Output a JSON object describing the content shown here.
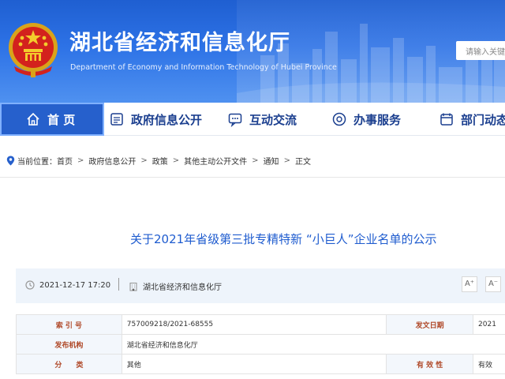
{
  "header": {
    "title": "湖北省经济和信息化厅",
    "subtitle": "Department of Economy and Information Technology of Hubei Province",
    "search_placeholder": "请输入关键",
    "brand_color": "#2d72e6"
  },
  "nav": {
    "items": [
      {
        "label": "首 页",
        "icon": "home-icon",
        "active": true
      },
      {
        "label": "政府信息公开",
        "icon": "document-icon",
        "active": false
      },
      {
        "label": "互动交流",
        "icon": "chat-icon",
        "active": false
      },
      {
        "label": "办事服务",
        "icon": "service-icon",
        "active": false
      },
      {
        "label": "部门动态",
        "icon": "news-icon",
        "active": false
      }
    ]
  },
  "breadcrumb": {
    "prefix": "当前位置：",
    "items": [
      "首页",
      "政府信息公开",
      "政策",
      "其他主动公开文件",
      "通知",
      "正文"
    ]
  },
  "article": {
    "title": "关于2021年省级第三批专精特新 “小巨人”企业名单的公示",
    "date": "2021-12-17 17:20",
    "source": "湖北省经济和信息化厅",
    "font_larger": "A⁺",
    "font_smaller": "A⁻"
  },
  "info_table": {
    "rows": [
      {
        "label1": "索 引 号",
        "value1": "757009218/2021-68555",
        "label2": "发文日期",
        "value2": "2021"
      },
      {
        "label1": "发布机构",
        "value1": "湖北省经济和信息化厅",
        "label2": "",
        "value2": ""
      },
      {
        "label1": "分　　类",
        "value1": "其他",
        "label2": "有 效 性",
        "value2": "有效"
      }
    ]
  }
}
